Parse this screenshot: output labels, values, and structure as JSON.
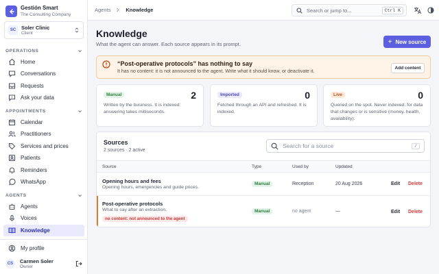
{
  "brand": {
    "name": "Gestión Smart",
    "subtitle": "The Consulting Company"
  },
  "client": {
    "initials": "SC",
    "name": "Soler Clinic",
    "role": "Client"
  },
  "sidebar": {
    "operations_label": "OPERATIONS",
    "operations": [
      {
        "label": "Home",
        "icon": "home-icon"
      },
      {
        "label": "Conversations",
        "icon": "chat-icon"
      },
      {
        "label": "Requests",
        "icon": "inbox-icon"
      },
      {
        "label": "Ask your data",
        "icon": "message-question-icon"
      }
    ],
    "appointments_label": "APPOINTMENTS",
    "appointments": [
      {
        "label": "Calendar",
        "icon": "calendar-icon"
      },
      {
        "label": "Practitioners",
        "icon": "users-icon"
      },
      {
        "label": "Services and prices",
        "icon": "tag-icon"
      },
      {
        "label": "Patients",
        "icon": "patients-icon"
      },
      {
        "label": "Reminders",
        "icon": "bell-icon"
      },
      {
        "label": "WhatsApp",
        "icon": "whatsapp-icon"
      }
    ],
    "agents_label": "AGENTS",
    "agents": [
      {
        "label": "Agents",
        "icon": "robot-icon"
      },
      {
        "label": "Voices",
        "icon": "microphone-icon"
      },
      {
        "label": "Knowledge",
        "icon": "book-icon",
        "active": true
      }
    ],
    "profile": {
      "label": "My profile",
      "icon": "user-circle-icon"
    }
  },
  "user": {
    "initials": "CS",
    "name": "Carmen Soler",
    "role": "Owner"
  },
  "topbar": {
    "breadcrumb_parent": "Agents",
    "breadcrumb_current": "Knowledge",
    "search_placeholder": "Search or jump to...",
    "search_shortcut": "Ctrl K"
  },
  "page": {
    "title": "Knowledge",
    "subtitle": "What the agent can answer. Each source appears in its prompt.",
    "new_button": "New source"
  },
  "alert": {
    "title": "“Post-operative protocols” has nothing to say",
    "text": "It has no content: it is not announced to the agent. Write what it should know, or deactivate it.",
    "button": "Add content"
  },
  "cards": [
    {
      "badge": "Manual",
      "count": "2",
      "desc": "Written by the business. It is indexed: answering takes milliseconds."
    },
    {
      "badge": "Imported",
      "count": "0",
      "desc": "Fetched through an API and refreshed. It is indexed."
    },
    {
      "badge": "Live",
      "count": "0",
      "desc": "Queried on the spot. Never indexed: for data that changes or is sensitive (money, health, availability)."
    }
  ],
  "sources": {
    "title": "Sources",
    "summary": "2 sources · 2 active",
    "search_placeholder": "Search for a source",
    "search_shortcut": "/",
    "columns": [
      "Source",
      "Type",
      "Used by",
      "Updated"
    ],
    "rows": [
      {
        "title": "Opening hours and fees",
        "subtitle": "Opening hours, emergencies and guide prices.",
        "type": "Manual",
        "used_by": "Reception",
        "updated": "20 Aug 2026",
        "edit": "Edit",
        "delete": "Delete"
      },
      {
        "title": "Post-operative protocols",
        "subtitle": "What to say after an extraction.",
        "warning": "no content: not announced to the agent",
        "type": "Manual",
        "used_by": "no agent",
        "updated": "—",
        "edit": "Edit",
        "delete": "Delete"
      }
    ]
  },
  "colors": {
    "accent": "#5b5fe0",
    "alert_bg": "#fff3e8",
    "danger": "#d03a3a",
    "manual": "#2f7d3e"
  }
}
